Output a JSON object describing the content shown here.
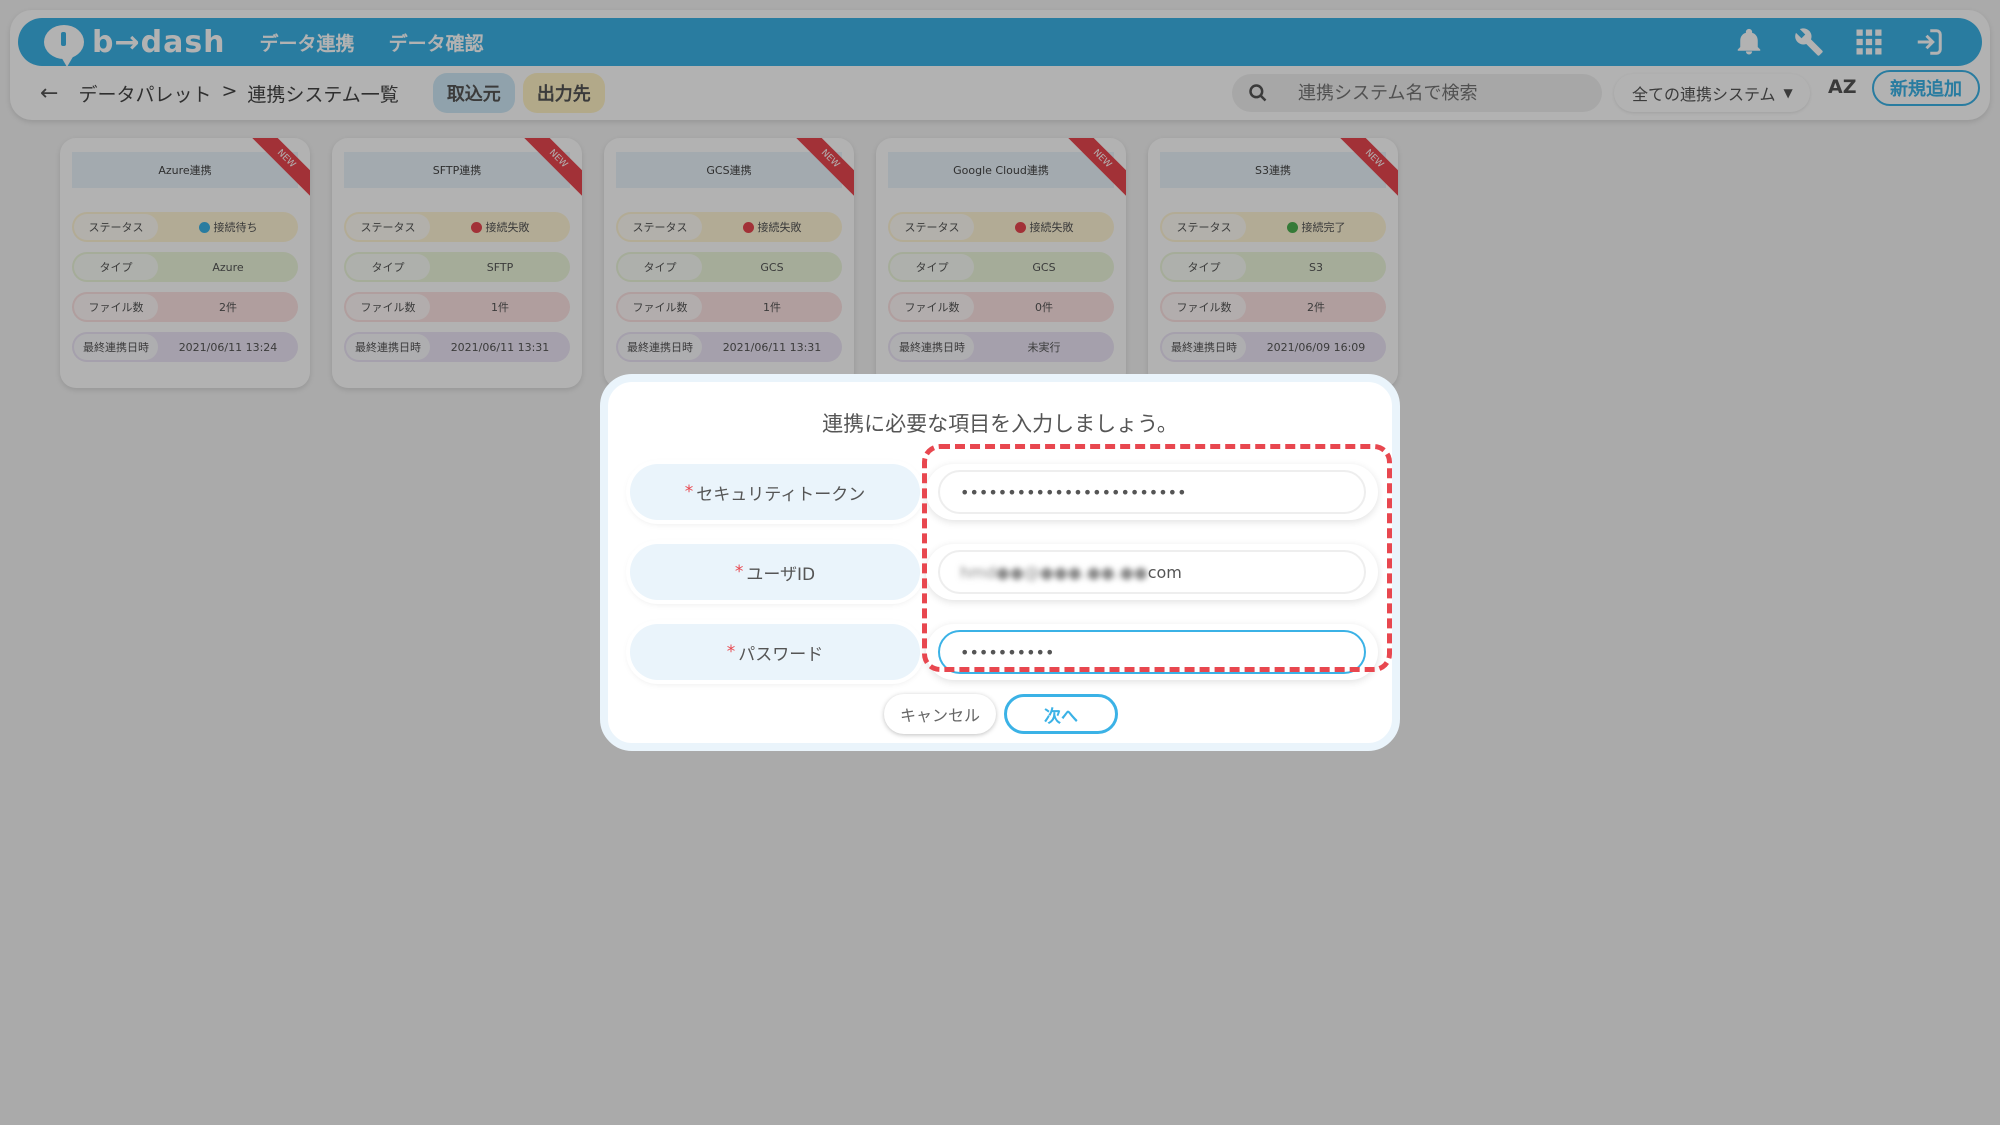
{
  "app": {
    "logo_text": "b→dash",
    "nav": [
      "データ連携",
      "データ確認"
    ],
    "icons": [
      "bell-icon",
      "wrench-icon",
      "grid-icon",
      "logout-icon"
    ]
  },
  "subbar": {
    "breadcrumb_parent": "データパレット",
    "breadcrumb_sep": ">",
    "breadcrumb_current": "連携システム一覧",
    "tab_in": "取込元",
    "tab_out": "出力先",
    "search_placeholder": "連携システム名で検索",
    "filter_value": "全ての連携システム",
    "sort_label": "AZ",
    "new_button": "新規追加"
  },
  "card_labels": {
    "status": "ステータス",
    "type": "タイプ",
    "files": "ファイル数",
    "last": "最終連携日時",
    "ribbon": "NEW"
  },
  "cards": [
    {
      "title": "Azure連携",
      "status": "接続待ち",
      "type": "Azure",
      "files": "2件",
      "last": "2021/06/11 13:24"
    },
    {
      "title": "SFTP連携",
      "status": "接続失敗",
      "type": "SFTP",
      "files": "1件",
      "last": "2021/06/11 13:31"
    },
    {
      "title": "GCS連携",
      "status": "接続失敗",
      "type": "GCS",
      "files": "1件",
      "last": "2021/06/11 13:31"
    },
    {
      "title": "Google Cloud連携",
      "status": "接続失敗",
      "type": "GCS",
      "files": "0件",
      "last": "未実行"
    },
    {
      "title": "S3連携",
      "status": "接続完了",
      "type": "S3",
      "files": "2件",
      "last": "2021/06/09 16:09"
    }
  ],
  "status_colors": {
    "waiting": "#3bb2e6",
    "failed": "#e8474f",
    "success": "#4caf50"
  },
  "modal": {
    "title": "連携に必要な項目を入力しましょう。",
    "required_mark": "*",
    "fields": [
      {
        "label": "セキュリティトークン",
        "value": "••••••••••••••••••••••••"
      },
      {
        "label": "ユーザID",
        "value_blurred": "hmd●●@●●●.●●.●●",
        "value_suffix": "com"
      },
      {
        "label": "パスワード",
        "value": "••••••••••"
      }
    ],
    "cancel": "キャンセル",
    "next": "次へ"
  }
}
